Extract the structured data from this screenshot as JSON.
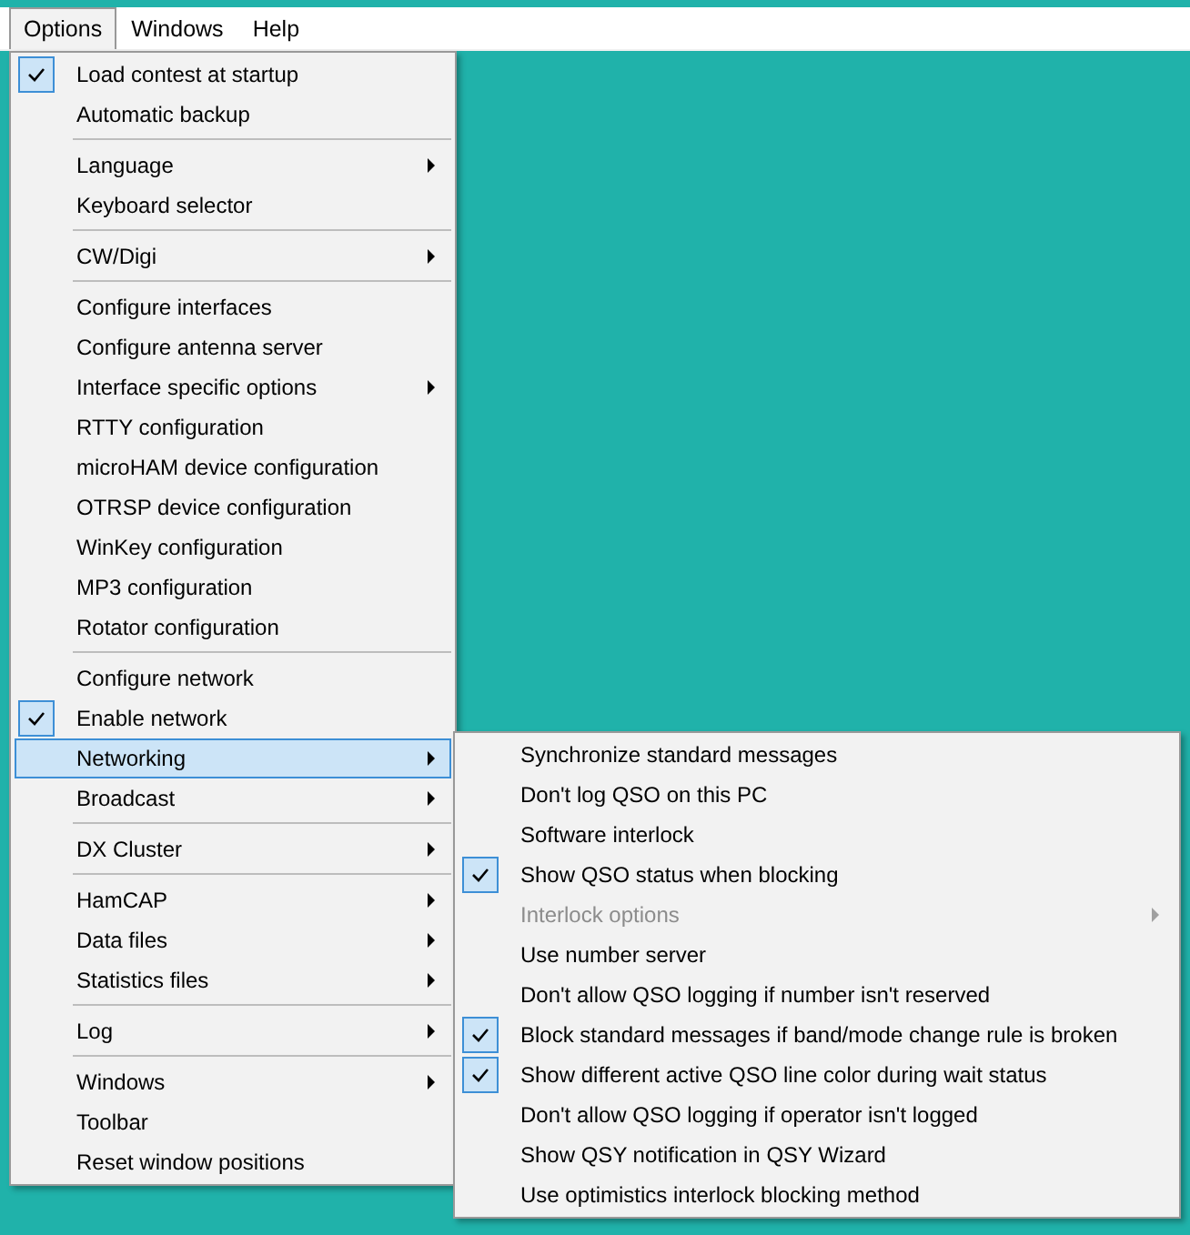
{
  "menu_bar": [
    {
      "label": "Options",
      "selected": true
    },
    {
      "label": "Windows",
      "selected": false
    },
    {
      "label": "Help",
      "selected": false
    }
  ],
  "options_menu": [
    {
      "kind": "item",
      "label": "Load contest at startup",
      "checked": true,
      "submenu": false,
      "selected": false
    },
    {
      "kind": "item",
      "label": "Automatic backup",
      "checked": false,
      "submenu": false,
      "selected": false
    },
    {
      "kind": "separator"
    },
    {
      "kind": "item",
      "label": "Language",
      "checked": false,
      "submenu": true,
      "selected": false
    },
    {
      "kind": "item",
      "label": "Keyboard selector",
      "checked": false,
      "submenu": false,
      "selected": false
    },
    {
      "kind": "separator"
    },
    {
      "kind": "item",
      "label": "CW/Digi",
      "checked": false,
      "submenu": true,
      "selected": false
    },
    {
      "kind": "separator"
    },
    {
      "kind": "item",
      "label": "Configure interfaces",
      "checked": false,
      "submenu": false,
      "selected": false
    },
    {
      "kind": "item",
      "label": "Configure antenna server",
      "checked": false,
      "submenu": false,
      "selected": false
    },
    {
      "kind": "item",
      "label": "Interface specific options",
      "checked": false,
      "submenu": true,
      "selected": false
    },
    {
      "kind": "item",
      "label": "RTTY configuration",
      "checked": false,
      "submenu": false,
      "selected": false
    },
    {
      "kind": "item",
      "label": "microHAM device configuration",
      "checked": false,
      "submenu": false,
      "selected": false
    },
    {
      "kind": "item",
      "label": "OTRSP device configuration",
      "checked": false,
      "submenu": false,
      "selected": false
    },
    {
      "kind": "item",
      "label": "WinKey configuration",
      "checked": false,
      "submenu": false,
      "selected": false
    },
    {
      "kind": "item",
      "label": "MP3 configuration",
      "checked": false,
      "submenu": false,
      "selected": false
    },
    {
      "kind": "item",
      "label": "Rotator configuration",
      "checked": false,
      "submenu": false,
      "selected": false
    },
    {
      "kind": "separator"
    },
    {
      "kind": "item",
      "label": "Configure network",
      "checked": false,
      "submenu": false,
      "selected": false
    },
    {
      "kind": "item",
      "label": "Enable network",
      "checked": true,
      "submenu": false,
      "selected": false
    },
    {
      "kind": "item",
      "label": "Networking",
      "checked": false,
      "submenu": true,
      "selected": true
    },
    {
      "kind": "item",
      "label": "Broadcast",
      "checked": false,
      "submenu": true,
      "selected": false
    },
    {
      "kind": "separator"
    },
    {
      "kind": "item",
      "label": "DX Cluster",
      "checked": false,
      "submenu": true,
      "selected": false
    },
    {
      "kind": "separator"
    },
    {
      "kind": "item",
      "label": "HamCAP",
      "checked": false,
      "submenu": true,
      "selected": false
    },
    {
      "kind": "item",
      "label": "Data files",
      "checked": false,
      "submenu": true,
      "selected": false
    },
    {
      "kind": "item",
      "label": "Statistics files",
      "checked": false,
      "submenu": true,
      "selected": false
    },
    {
      "kind": "separator"
    },
    {
      "kind": "item",
      "label": "Log",
      "checked": false,
      "submenu": true,
      "selected": false
    },
    {
      "kind": "separator"
    },
    {
      "kind": "item",
      "label": "Windows",
      "checked": false,
      "submenu": true,
      "selected": false
    },
    {
      "kind": "item",
      "label": "Toolbar",
      "checked": false,
      "submenu": false,
      "selected": false
    },
    {
      "kind": "item",
      "label": "Reset window positions",
      "checked": false,
      "submenu": false,
      "selected": false
    }
  ],
  "networking_submenu": [
    {
      "label": "Synchronize standard messages",
      "checked": false,
      "disabled": false,
      "submenu": false
    },
    {
      "label": "Don't log QSO on this PC",
      "checked": false,
      "disabled": false,
      "submenu": false
    },
    {
      "label": "Software interlock",
      "checked": false,
      "disabled": false,
      "submenu": false
    },
    {
      "label": "Show QSO status when blocking",
      "checked": true,
      "disabled": false,
      "submenu": false
    },
    {
      "label": "Interlock options",
      "checked": false,
      "disabled": true,
      "submenu": true
    },
    {
      "label": "Use number server",
      "checked": false,
      "disabled": false,
      "submenu": false
    },
    {
      "label": "Don't allow QSO logging if number isn't reserved",
      "checked": false,
      "disabled": false,
      "submenu": false
    },
    {
      "label": "Block standard messages if band/mode change rule is broken",
      "checked": true,
      "disabled": false,
      "submenu": false
    },
    {
      "label": "Show different active QSO line color during wait status",
      "checked": true,
      "disabled": false,
      "submenu": false
    },
    {
      "label": "Don't allow QSO logging if operator isn't logged",
      "checked": false,
      "disabled": false,
      "submenu": false
    },
    {
      "label": "Show QSY notification in QSY Wizard",
      "checked": false,
      "disabled": false,
      "submenu": false
    },
    {
      "label": "Use optimistics interlock blocking method",
      "checked": false,
      "disabled": false,
      "submenu": false
    }
  ]
}
